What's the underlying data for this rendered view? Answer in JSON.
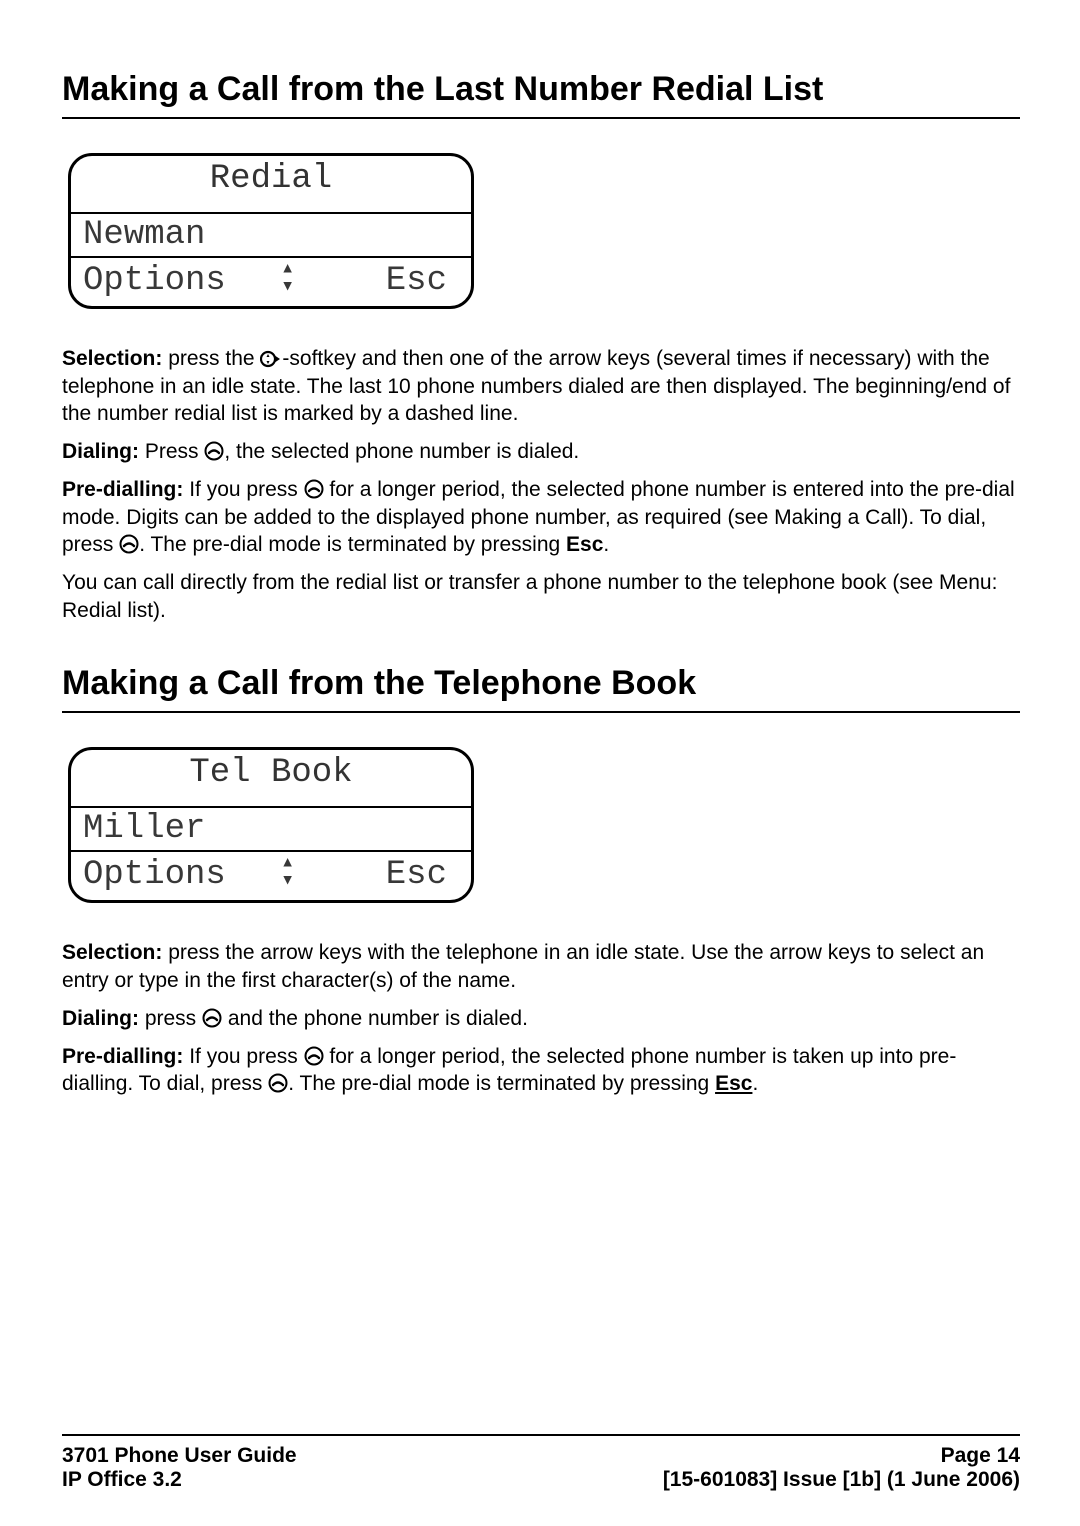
{
  "section1": {
    "heading": "Making a Call from the Last Number Redial List",
    "lcd": {
      "title": "Redial",
      "name": "Newman",
      "options": "Options",
      "esc": "Esc"
    },
    "p1_label": "Selection:",
    "p1_a": " press the ",
    "p1_b": "-softkey and then one of the arrow keys (several times if necessary) with the telephone in an idle state. The last 10 phone numbers dialed are then displayed. The beginning/end of the number redial list is marked by a dashed line.",
    "p2_label": "Dialing:",
    "p2_a": " Press ",
    "p2_b": ", the selected phone number is dialed.",
    "p3_label": "Pre-dialling:",
    "p3_a": " If you press ",
    "p3_b": " for a longer period, the selected phone number is entered into the pre-dial mode. Digits can be added to the displayed phone number, as required (see Making a Call). To dial, press ",
    "p3_c": ". The pre-dial mode is terminated by pressing ",
    "p3_esc": "Esc",
    "p3_d": ".",
    "p4": "You can call directly from the redial list or transfer a phone number to the telephone book (see Menu: Redial list)."
  },
  "section2": {
    "heading": "Making a Call from the Telephone Book",
    "lcd": {
      "title": "Tel Book",
      "name": "Miller",
      "options": "Options",
      "esc": "Esc"
    },
    "p1_label": "Selection:",
    "p1": " press the arrow keys with the telephone in an idle state. Use the arrow keys to select an entry or type in the first character(s) of the name.",
    "p2_label": "Dialing:",
    "p2_a": " press ",
    "p2_b": " and the phone number is dialed.",
    "p3_label": "Pre-dialling:",
    "p3_a": " If you press ",
    "p3_b": " for a longer period, the selected phone number is taken up into pre-dialling. To dial, press ",
    "p3_c": ". The pre-dial mode is terminated by pressing ",
    "p3_esc": "Esc",
    "p3_d": "."
  },
  "footer": {
    "left1": "3701 Phone User Guide",
    "right1": "Page 14",
    "left2": "IP Office 3.2",
    "right2": "[15-601083] Issue [1b] (1 June 2006)"
  }
}
